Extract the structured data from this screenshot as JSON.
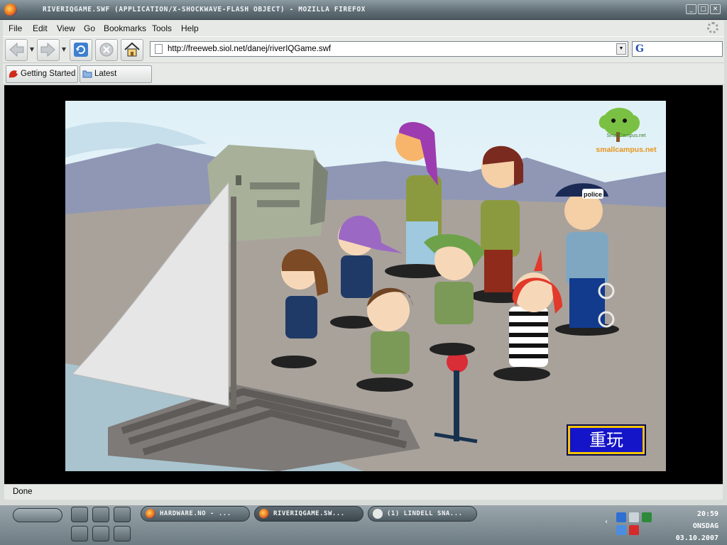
{
  "window": {
    "title": "riverIQGame.swf (application/x-shockwave-flash Object) - Mozilla Firefox",
    "controls": [
      "_",
      "□",
      "✕"
    ]
  },
  "menu": {
    "file": "File",
    "edit": "Edit",
    "view": "View",
    "go": "Go",
    "bookmarks": "Bookmarks",
    "tools": "Tools",
    "help": "Help"
  },
  "nav": {
    "url": "http://freeweb.siol.net/danej/riverIQGame.swf",
    "search_engine": "G"
  },
  "bookmarks": [
    {
      "label": "Getting Started"
    },
    {
      "label": "Latest Headlines"
    }
  ],
  "flash": {
    "logo_text": "smallcampus.net",
    "logo_small": "SmallCampus.net",
    "police_cap": "police",
    "replay_button": "重玩"
  },
  "status": {
    "text": "Done"
  },
  "taskbar": {
    "tasks": [
      {
        "label": "hardware.no - ..."
      },
      {
        "label": "riverIQGame.sw..."
      },
      {
        "label": "(1) Lindell Sna..."
      }
    ],
    "clock": {
      "time": "20:59",
      "day": "onsdag",
      "date": "03.10.2007"
    }
  },
  "colors": {
    "titlebar": "#5f6d75",
    "chrome": "#e7e9e6",
    "replay_bg": "#1414c8",
    "replay_border": "#f2c400"
  }
}
